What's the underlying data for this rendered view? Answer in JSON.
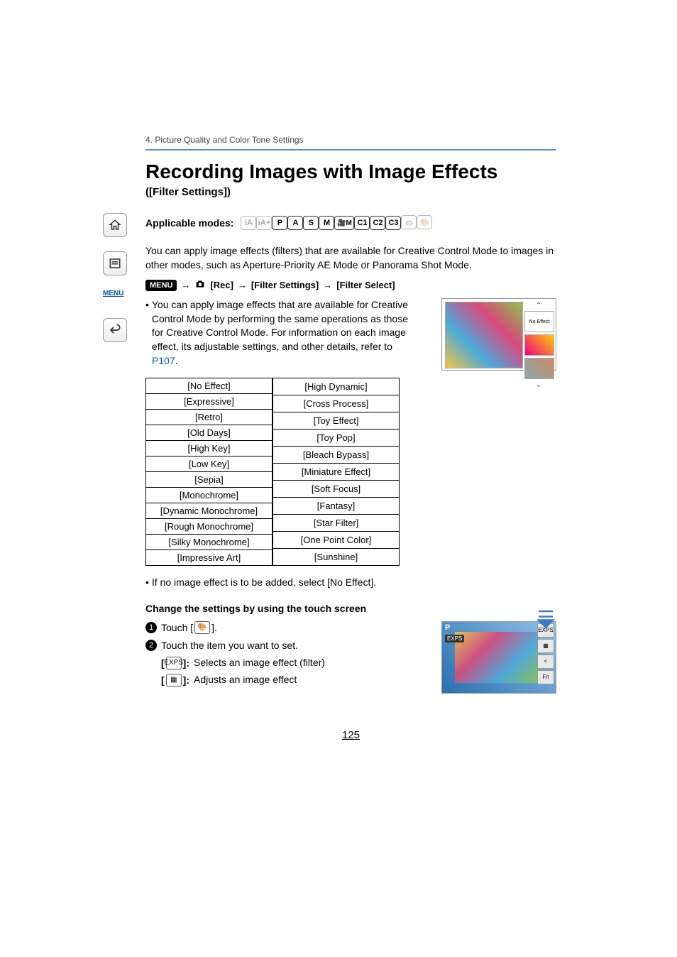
{
  "breadcrumb": "4. Picture Quality and Color Tone Settings",
  "title": "Recording Images with Image Effects",
  "subtitle": "([Filter Settings])",
  "applicable_modes_label": "Applicable modes:",
  "modes": [
    {
      "label": "iA",
      "dim": true
    },
    {
      "label": "iA+",
      "dim": true
    },
    {
      "label": "P",
      "dim": false
    },
    {
      "label": "A",
      "dim": false
    },
    {
      "label": "S",
      "dim": false
    },
    {
      "label": "M",
      "dim": false
    },
    {
      "label": "🎥M",
      "dim": false,
      "wide": true
    },
    {
      "label": "C1",
      "dim": false
    },
    {
      "label": "C2",
      "dim": false
    },
    {
      "label": "C3",
      "dim": false
    },
    {
      "label": "▭",
      "dim": true
    },
    {
      "label": "🎨",
      "dim": true
    }
  ],
  "intro": "You can apply image effects (filters) that are available for Creative Control Mode to images in other modes, such as Aperture-Priority AE Mode or Panorama Shot Mode.",
  "menu_chip": "MENU",
  "menu_path": {
    "rec": "[Rec]",
    "filter_settings": "[Filter Settings]",
    "filter_select": "[Filter Select]"
  },
  "bullet1_pre": "You can apply image effects that are available for Creative Control Mode by performing the same operations as those for Creative Control Mode. For information on each image effect, its adjustable settings, and other details, refer to ",
  "bullet1_link": "P107",
  "bullet1_post": ".",
  "effects_col1": [
    "[No Effect]",
    "[Expressive]",
    "[Retro]",
    "[Old Days]",
    "[High Key]",
    "[Low Key]",
    "[Sepia]",
    "[Monochrome]",
    "[Dynamic Monochrome]",
    "[Rough Monochrome]",
    "[Silky Monochrome]",
    "[Impressive Art]"
  ],
  "effects_col2": [
    "[High Dynamic]",
    "[Cross Process]",
    "[Toy Effect]",
    "[Toy Pop]",
    "[Bleach Bypass]",
    "[Miniature Effect]",
    "[Soft Focus]",
    "[Fantasy]",
    "[Star Filter]",
    "[One Point Color]",
    "[Sunshine]"
  ],
  "preview_no_effect": "No Effect",
  "bullet2": "If no image effect is to be added, select [No Effect].",
  "touch_heading": "Change the settings by using the touch screen",
  "step1": "Touch [",
  "step1_icon": "🎨",
  "step1_end": "].",
  "step2": "Touch the item you want to set.",
  "desc1_label": "EXPS",
  "desc1_text": "Selects an image effect (filter)",
  "desc2_label": "▦",
  "desc2_text": "Adjusts an image effect",
  "tp_p": "P",
  "tp_exps": "EXPS",
  "tp_side1": "EXPS",
  "tp_side2": "▦",
  "tp_side3": "<",
  "tp_side4": "Fn",
  "sidebar_menu": "MENU",
  "page_num": "125"
}
